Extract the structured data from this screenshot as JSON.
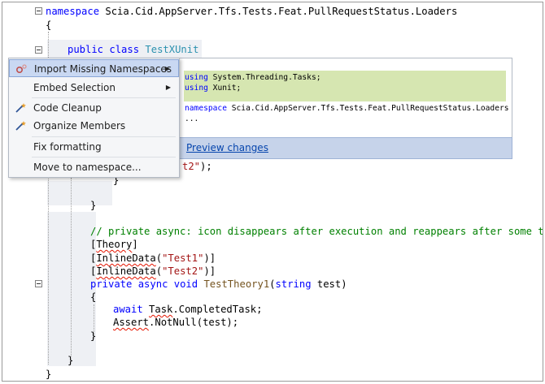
{
  "editor": {
    "lines": {
      "namespace_kw": "namespace",
      "namespace_name": " Scia.Cid.AppServer.Tfs.Tests.Feat.PullRequestStatus.Loaders",
      "open_brace_1": "{",
      "class_public": "public",
      "class_kw": "class",
      "class_name": "TestXUnit",
      "partial_string": "t2\");",
      "close_brace_a": "}",
      "close_brace_b": "}",
      "comment": "// private async: icon disappears after execution and reappears after some time",
      "attr_theory_open": "[",
      "attr_theory": "Theory",
      "attr_theory_close": "]",
      "inline1_open": "[",
      "inline1_name": "InlineData",
      "inline1_paren": "(",
      "inline1_str": "\"Test1\"",
      "inline1_close": ")]",
      "inline2_open": "[",
      "inline2_name": "InlineData",
      "inline2_paren": "(",
      "inline2_str": "\"Test2\"",
      "inline2_close": ")]",
      "m_private": "private",
      "m_async": "async",
      "m_void": "void",
      "m_name": "TestTheory1",
      "m_params_open": "(",
      "m_string": "string",
      "m_param": " test)",
      "m_brace_open": "{",
      "await_kw": "await",
      "await_task": "Task",
      "await_rest": ".CompletedTask;",
      "assert_obj": "Assert",
      "assert_rest": ".NotNull(test);",
      "m_brace_close": "}",
      "class_brace_close": "}",
      "ns_brace_close": "}"
    }
  },
  "context_menu": {
    "items": [
      {
        "label": "Import Missing Namespaces",
        "icon": "gear-icon",
        "submenu": true,
        "selected": true
      },
      {
        "label": "Embed Selection",
        "icon": "",
        "submenu": true,
        "selected": false
      },
      {
        "label": "Code Cleanup",
        "icon": "magic-wand-icon",
        "submenu": false,
        "selected": false
      },
      {
        "label": "Organize Members",
        "icon": "magic-wand-icon",
        "submenu": false,
        "selected": false
      },
      {
        "label": "Fix formatting",
        "icon": "",
        "submenu": false,
        "selected": false
      },
      {
        "label": "Move to namespace...",
        "icon": "",
        "submenu": false,
        "selected": false
      }
    ]
  },
  "preview": {
    "using1_kw": "using",
    "using1_ns": " System.Threading.Tasks;",
    "using2_kw": "using",
    "using2_ns": " Xunit;",
    "ns_kw": "namespace",
    "ns_name": " Scia.Cid.AppServer.Tfs.Tests.Feat.PullRequestStatus.Loaders",
    "ellipsis": "...",
    "link_label": "Preview changes"
  },
  "colors": {
    "keyword": "#0000ff",
    "type": "#2b91af",
    "string": "#a31515",
    "comment": "#008000",
    "menu_selected": "#c9d8f2",
    "preview_added": "#d6e6b1",
    "link": "#0645ad"
  }
}
